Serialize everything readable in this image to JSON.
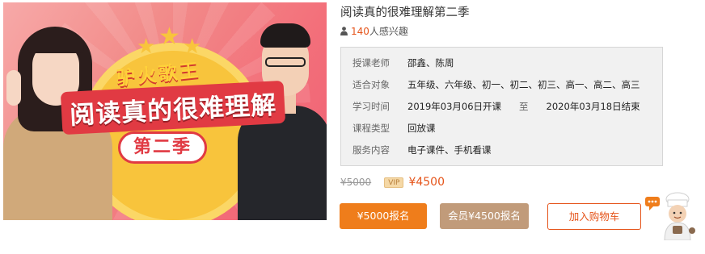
{
  "course": {
    "cover_title_line1": "驴火歌王",
    "cover_title_line2": "阅读真的很难理解",
    "cover_title_line3": "第二季",
    "title": "阅读真的很难理解第二季",
    "interest_count": "140",
    "interest_suffix": "人感兴趣"
  },
  "info": {
    "teacher_label": "授课老师",
    "teacher_value": "邵鑫、陈周",
    "audience_label": "适合对象",
    "audience_value": "五年级、六年级、初一、初二、初三、高一、高二、高三",
    "time_label": "学习时间",
    "time_start": "2019年03月06日开课",
    "time_sep": "至",
    "time_end": "2020年03月18日结束",
    "type_label": "课程类型",
    "type_value": "回放课",
    "service_label": "服务内容",
    "service_value": "电子课件、手机看课"
  },
  "pricing": {
    "original_price": "¥5000",
    "vip_badge": "VIP",
    "vip_price": "¥4500"
  },
  "buttons": {
    "enroll": "¥5000报名",
    "vip_enroll": "会员¥4500报名",
    "add_to_cart": "加入购物车"
  },
  "colors": {
    "accent_orange": "#ef7d1b",
    "price_red": "#e5541a",
    "vip_brown": "#c19b7a"
  },
  "icons": {
    "interest": "person-icon",
    "chat": "chef-mascot-icon"
  }
}
